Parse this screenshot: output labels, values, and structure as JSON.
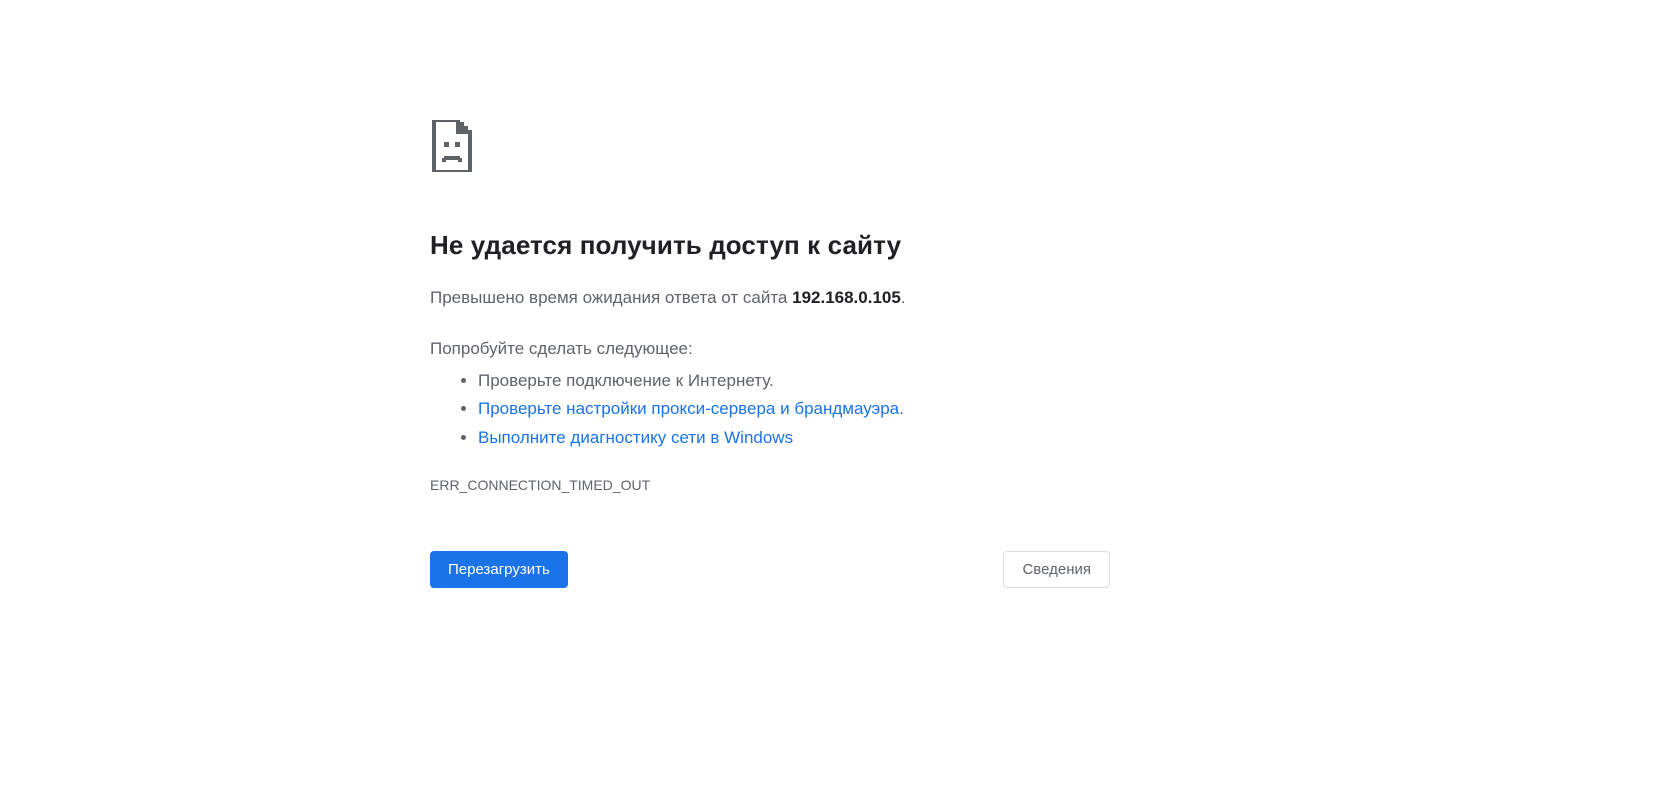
{
  "title": "Не удается получить доступ к сайту",
  "desc_prefix": "Превышено время ожидания ответа от сайта ",
  "desc_host": "192.168.0.105",
  "desc_suffix": ".",
  "try_label": "Попробуйте сделать следующее:",
  "suggestions": {
    "item0_text": "Проверьте подключение к Интернету.",
    "item1_link": "Проверьте настройки прокси-сервера и брандмауэра",
    "item1_suffix": ".",
    "item2_link": "Выполните диагностику сети в Windows"
  },
  "error_code": "ERR_CONNECTION_TIMED_OUT",
  "buttons": {
    "reload": "Перезагрузить",
    "details": "Сведения"
  }
}
